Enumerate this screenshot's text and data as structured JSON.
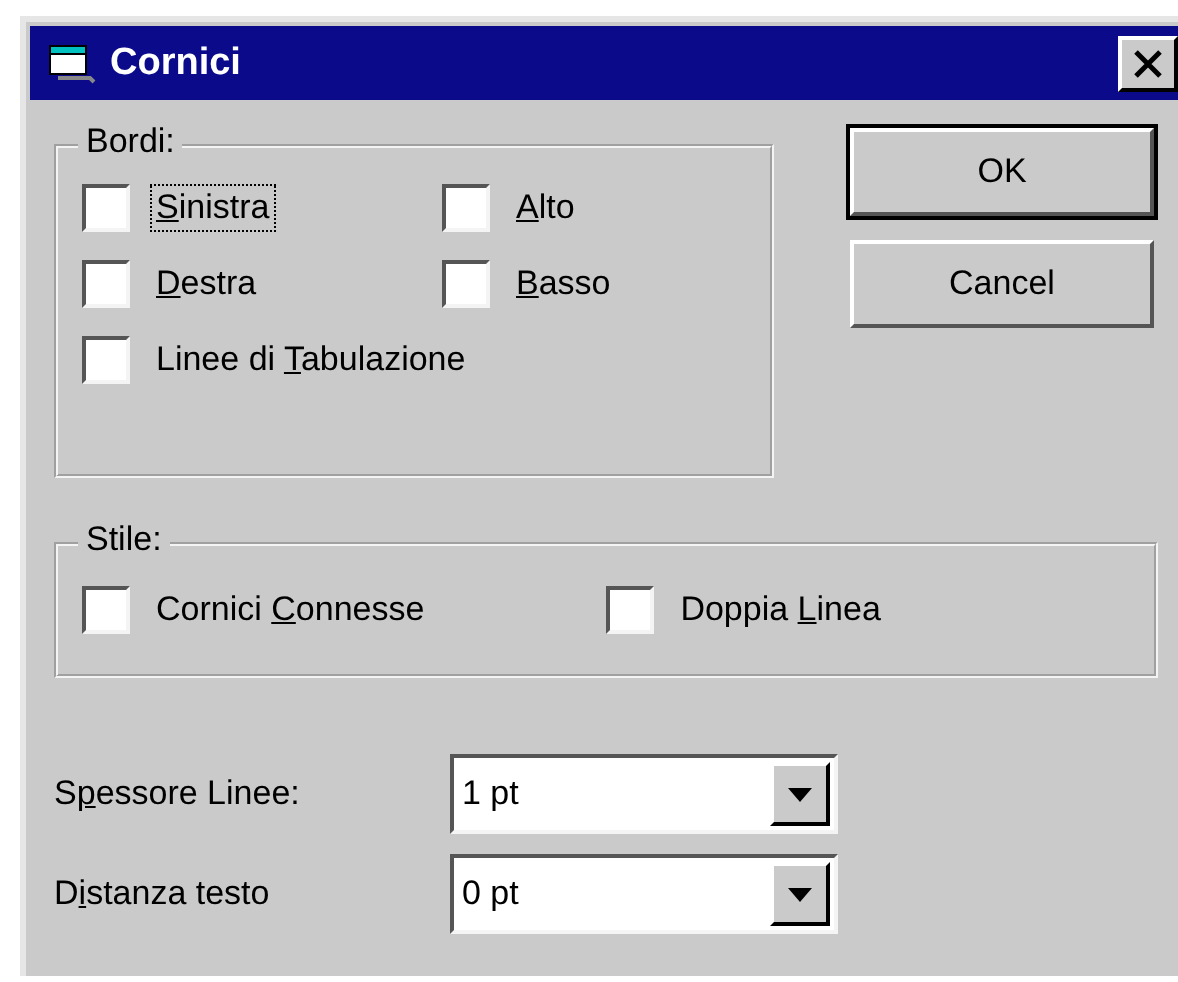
{
  "window": {
    "title": "Cornici"
  },
  "bordi": {
    "title": "Bordi:",
    "options": [
      {
        "key": "S",
        "after": "inistra",
        "checked": false,
        "focused": true
      },
      {
        "key": "A",
        "after": "lto",
        "checked": false,
        "focused": false
      },
      {
        "key": "D",
        "after": "estra",
        "checked": false,
        "focused": false
      },
      {
        "key": "B",
        "after": "asso",
        "checked": false,
        "focused": false
      },
      {
        "before": "Linee di ",
        "key": "T",
        "after": "abulazione",
        "checked": false,
        "focused": false
      }
    ]
  },
  "stile": {
    "title": "Stile:",
    "options": [
      {
        "before": "Cornici ",
        "key": "C",
        "after": "onnesse",
        "checked": false,
        "focused": false
      },
      {
        "before": "Doppia ",
        "key": "L",
        "after": "inea",
        "checked": false,
        "focused": false
      }
    ]
  },
  "buttons": [
    {
      "label": "OK",
      "default": true
    },
    {
      "label": "Cancel",
      "default": false
    }
  ],
  "fields": [
    {
      "before": "S",
      "key": "p",
      "after": "essore Linee:",
      "value": "1 pt"
    },
    {
      "before": "D",
      "key": "i",
      "after": "stanza testo",
      "value": "0 pt"
    }
  ]
}
